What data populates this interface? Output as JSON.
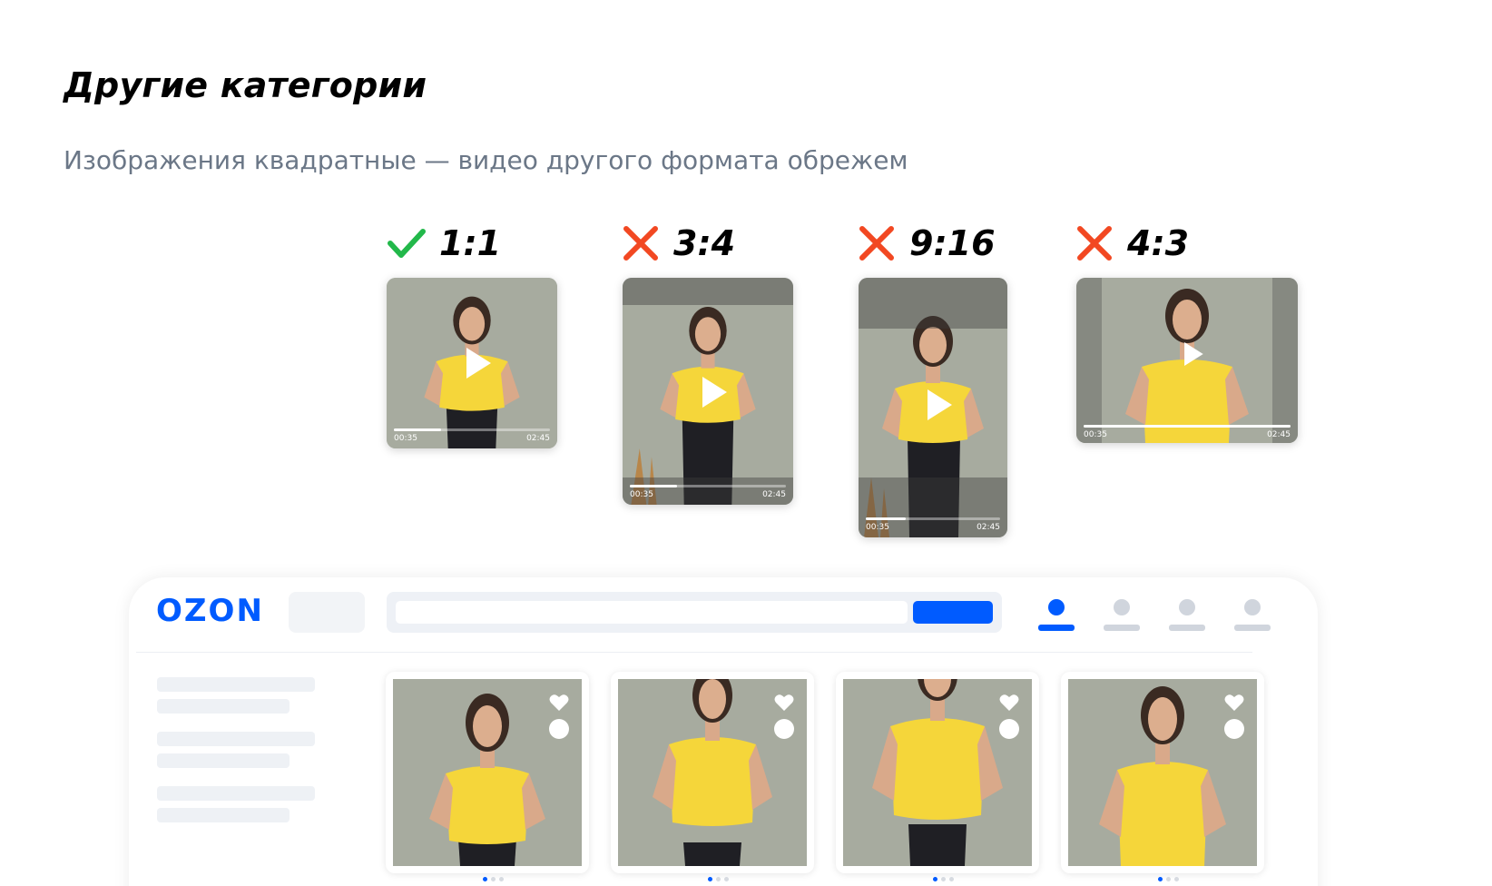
{
  "heading": "Другие категории",
  "subheading": "Изображения квадратные — видео другого формата обрежем",
  "ratios": [
    {
      "label": "1:1",
      "status": "ok",
      "icon": "check-icon",
      "elapsed": "00:35",
      "total": "02:45",
      "progress": 0.3
    },
    {
      "label": "3:4",
      "status": "bad",
      "icon": "cross-icon",
      "elapsed": "00:35",
      "total": "02:45",
      "progress": 0.3
    },
    {
      "label": "9:16",
      "status": "bad",
      "icon": "cross-icon",
      "elapsed": "00:35",
      "total": "02:45",
      "progress": 0.3
    },
    {
      "label": "4:3",
      "status": "bad",
      "icon": "cross-icon",
      "elapsed": "00:35",
      "total": "02:45",
      "progress": 1.0
    }
  ],
  "colors": {
    "brand": "#005bff",
    "check": "#22b84a",
    "cross": "#f24822",
    "subtitle": "#6b7787",
    "backdrop": "#a7ab9f",
    "shirt": "#f5d63a"
  },
  "store": {
    "logo": "OZON",
    "nav_icons": [
      "profile-icon",
      "orders-icon",
      "favorites-icon",
      "cart-icon"
    ],
    "cards": [
      {
        "active_dot": 0,
        "dots": 3
      },
      {
        "active_dot": 0,
        "dots": 3
      },
      {
        "active_dot": 0,
        "dots": 3
      },
      {
        "active_dot": 0,
        "dots": 3
      }
    ]
  }
}
